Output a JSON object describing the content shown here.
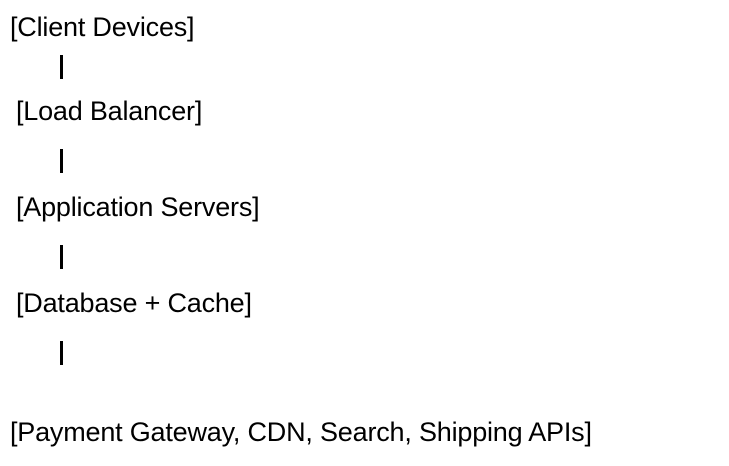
{
  "diagram": {
    "nodes": [
      "[Client Devices]",
      "[Load Balancer]",
      "[Application Servers]",
      "[Database + Cache]",
      "[Payment Gateway, CDN, Search, Shipping APIs]"
    ],
    "connector_glyph": "|"
  }
}
